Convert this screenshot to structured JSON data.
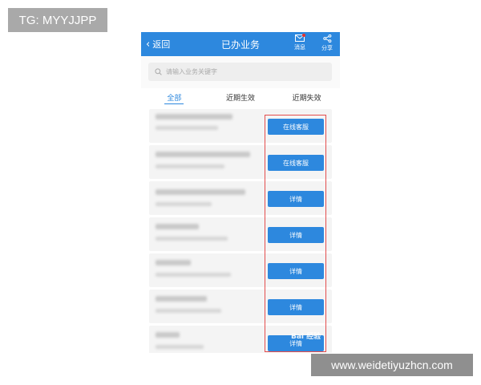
{
  "overlay": {
    "tg_label": "TG: MYYJJPP",
    "watermark": "www.weidetiyuzhcn.com"
  },
  "header": {
    "back_label": "返回",
    "title": "已办业务",
    "message_label": "消息",
    "share_label": "分享",
    "background_color": "#2d88de",
    "notification_dot_color": "#e6322d"
  },
  "search": {
    "placeholder": "请输入业务关键字"
  },
  "tabs": [
    {
      "label": "全部",
      "active": true
    },
    {
      "label": "近期生效",
      "active": false
    },
    {
      "label": "近期失效",
      "active": false
    }
  ],
  "rows": [
    {
      "button_label": "在线客服",
      "blurred": true
    },
    {
      "button_label": "在线客服",
      "blurred": true
    },
    {
      "button_label": "详情",
      "blurred": true
    },
    {
      "button_label": "详情",
      "blurred": true
    },
    {
      "button_label": "详情",
      "blurred": true
    },
    {
      "button_label": "详情",
      "blurred": true
    },
    {
      "button_label": "详情",
      "blurred": true
    }
  ],
  "highlight_box_color": "#e34d4d",
  "baidu_watermark": "Bai 经验"
}
